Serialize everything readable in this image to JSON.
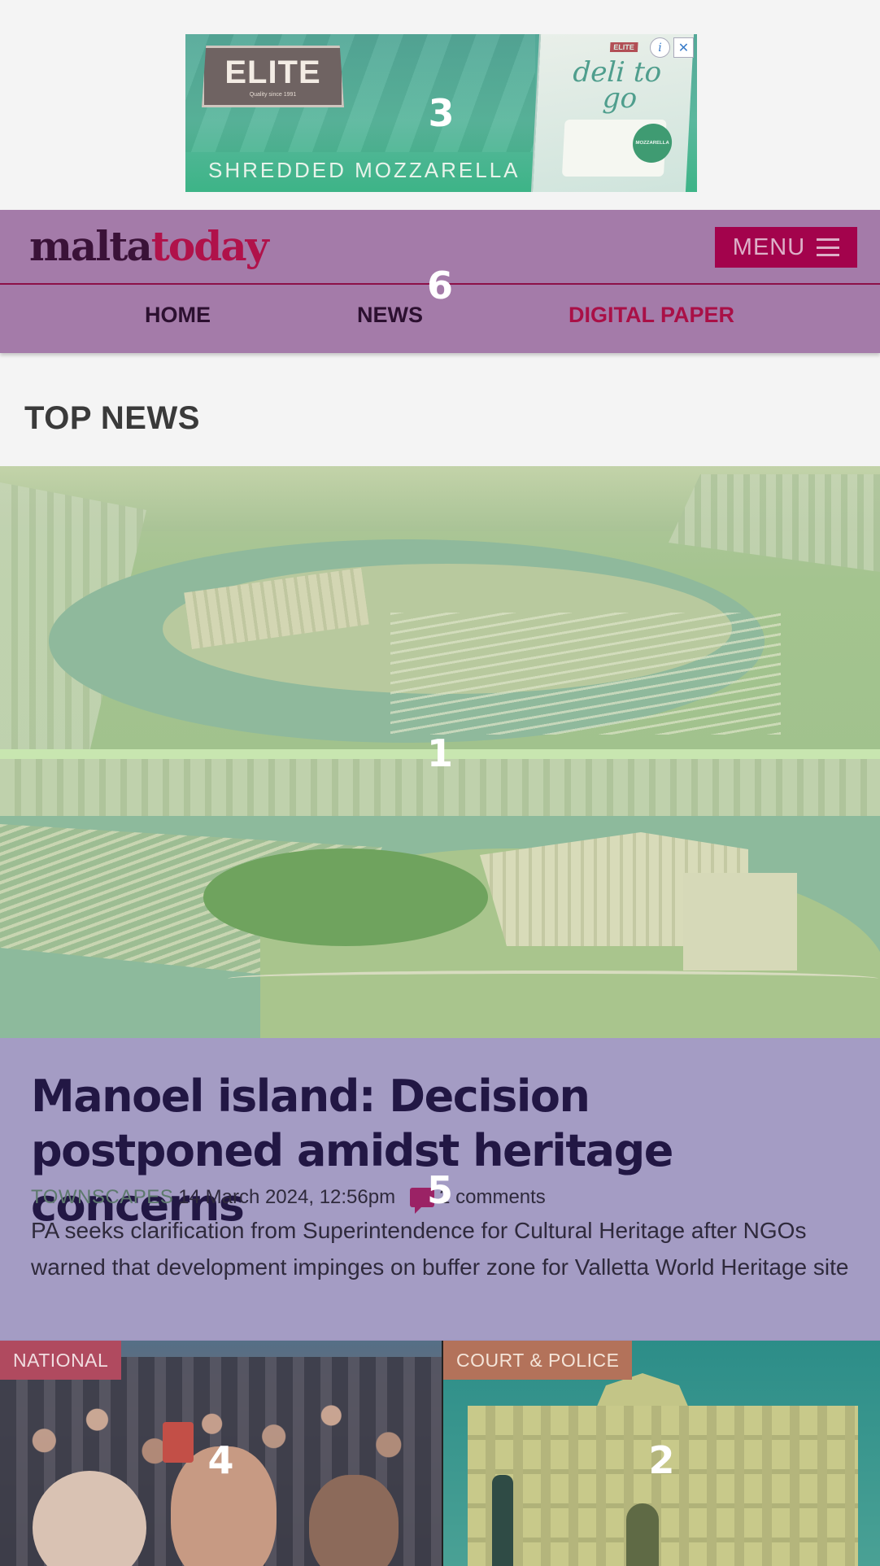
{
  "ad": {
    "brand": "ELITE",
    "brand_sub": "Quality since 1991",
    "tagline": "SHREDDED MOZZARELLA",
    "pack_brand": "ELITE",
    "pack_script_1": "deli to",
    "pack_script_2": "go",
    "pack_seal": "MOZZARELLA",
    "info_icon": "i",
    "close_icon": "✕",
    "number": "3"
  },
  "header": {
    "logo_part1": "malta",
    "logo_part2": "today",
    "menu_label": "MENU",
    "number": "6",
    "nav": [
      {
        "label": "HOME"
      },
      {
        "label": "NEWS"
      },
      {
        "label": "DIGITAL PAPER"
      }
    ]
  },
  "section": {
    "title": "TOP NEWS"
  },
  "hero": {
    "number": "1"
  },
  "article": {
    "headline": "Manoel island: Decision postponed amidst heritage concerns",
    "category": "TOWNSCAPES",
    "date": "14 March 2024, 12:56pm",
    "comments": "2 comments",
    "summary": "PA seeks clarification from Superintendence for Cultural Heritage after NGOs warned that development impinges on buffer zone for Valletta World Heritage site",
    "number": "5"
  },
  "cards": [
    {
      "tag": "NATIONAL",
      "number": "4"
    },
    {
      "tag": "COURT & POLICE",
      "number": "2"
    }
  ],
  "colors": {
    "brand_dark": "#3a1238",
    "brand_accent": "#b0124a",
    "menu_bg": "#a3034c"
  }
}
